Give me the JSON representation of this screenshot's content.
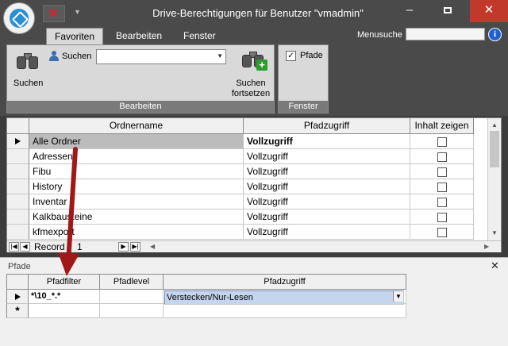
{
  "window": {
    "title": "Drive-Berechtigungen für Benutzer \"vmadmin\"",
    "minimize": "–",
    "close": "✕"
  },
  "ribbon": {
    "tabs": [
      "Favoriten",
      "Bearbeiten",
      "Fenster"
    ],
    "active_tab": "Favoriten",
    "menusuche_label": "Menusuche",
    "menusuche_value": "",
    "info_icon": "i",
    "groups": {
      "bearbeiten": {
        "label": "Bearbeiten",
        "suchen_big_label": "Suchen",
        "suchen_small_label": "Suchen",
        "suchen_combo_value": "",
        "fortsetzen_label": "Suchen fortsetzen"
      },
      "fenster": {
        "label": "Fenster",
        "pfade_label": "Pfade",
        "pfade_checked": true
      }
    }
  },
  "folders_grid": {
    "columns": [
      "Ordnername",
      "Pfadzugriff",
      "Inhalt zeigen"
    ],
    "rows": [
      {
        "name": "Alle Ordner",
        "zugriff": "Vollzugriff",
        "inhalt": false
      },
      {
        "name": "Adressen",
        "zugriff": "Vollzugriff",
        "inhalt": false
      },
      {
        "name": "Fibu",
        "zugriff": "Vollzugriff",
        "inhalt": false
      },
      {
        "name": "History",
        "zugriff": "Vollzugriff",
        "inhalt": false
      },
      {
        "name": "Inventar",
        "zugriff": "Vollzugriff",
        "inhalt": false
      },
      {
        "name": "Kalkbausteine",
        "zugriff": "Vollzugriff",
        "inhalt": false
      },
      {
        "name": "kfmexport",
        "zugriff": "Vollzugriff",
        "inhalt": false
      }
    ],
    "navigator": {
      "record_label": "Record",
      "record_value": "1"
    }
  },
  "pfade_panel": {
    "title": "Pfade",
    "close": "✕",
    "columns": [
      "Pfadfilter",
      "Pfadlevel",
      "Pfadzugriff"
    ],
    "rows": [
      {
        "filter": "*\\10_*.*",
        "level": "",
        "zugriff": "Verstecken/Nur-Lesen"
      }
    ],
    "new_row_marker": "*"
  },
  "colors": {
    "chrome": "#4a4a4a",
    "ribbon": "#d9d9d9",
    "close_button": "#c0392b",
    "selection": "#c5d5ee",
    "annotation_arrow": "#a01818"
  }
}
